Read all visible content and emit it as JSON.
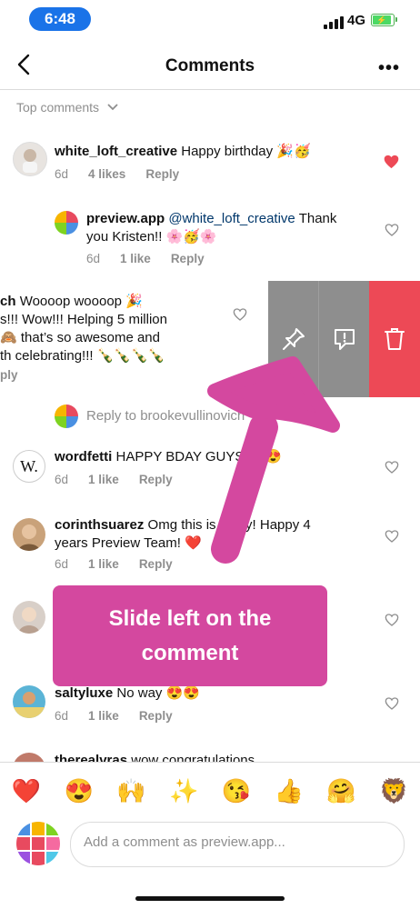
{
  "status": {
    "time": "6:48",
    "network": "4G"
  },
  "header": {
    "title": "Comments"
  },
  "filter": {
    "label": "Top comments"
  },
  "comments": [
    {
      "user": "white_loft_creative",
      "text": "Happy birthday 🎉🥳",
      "time": "6d",
      "likes": "4 likes",
      "reply": "Reply"
    },
    {
      "user": "preview.app",
      "mention": "@white_loft_creative",
      "text": "Thank you Kristen!! 🌸🥳🌸",
      "time": "6d",
      "likes": "1 like",
      "reply": "Reply"
    },
    {
      "user": "ch",
      "text_lines": [
        "Woooop woooop 🎉",
        "s!!! Wow!!! Helping 5 million",
        "🙈 that’s so awesome and",
        "th celebrating!!! 🍾🍾🍾🍾"
      ],
      "reply": "ply"
    },
    {
      "user": "wordfetti",
      "text": "HAPPY BDAY GUYS 😍😍",
      "time": "6d",
      "likes": "1 like",
      "reply": "Reply"
    },
    {
      "user": "corinthsuarez",
      "text_lines": [
        "Omg this is crazy! Happy 4",
        "years Preview Team! ❤️"
      ],
      "time": "6d",
      "likes": "1 like",
      "reply": "Reply"
    },
    {
      "user": "saltyluxe",
      "text": "No way 😍😍",
      "time": "6d",
      "likes": "1 like",
      "reply": "Reply"
    },
    {
      "user": "therealvras",
      "text": "wow congratulations"
    }
  ],
  "reply_prompt": "Reply to brookevullinovich",
  "callout": {
    "line1": "Slide left on the",
    "line2": "comment"
  },
  "emojis": [
    "❤️",
    "😍",
    "🙌",
    "✨",
    "😘",
    "👍",
    "🤗",
    "🦁"
  ],
  "input": {
    "placeholder": "Add a comment as preview.app..."
  },
  "colors": {
    "accent": "#d4489f",
    "delete": "#ed4956",
    "pin": "#8e8e8e",
    "report": "#8e8e8e",
    "status_pill": "#1a73e8"
  }
}
